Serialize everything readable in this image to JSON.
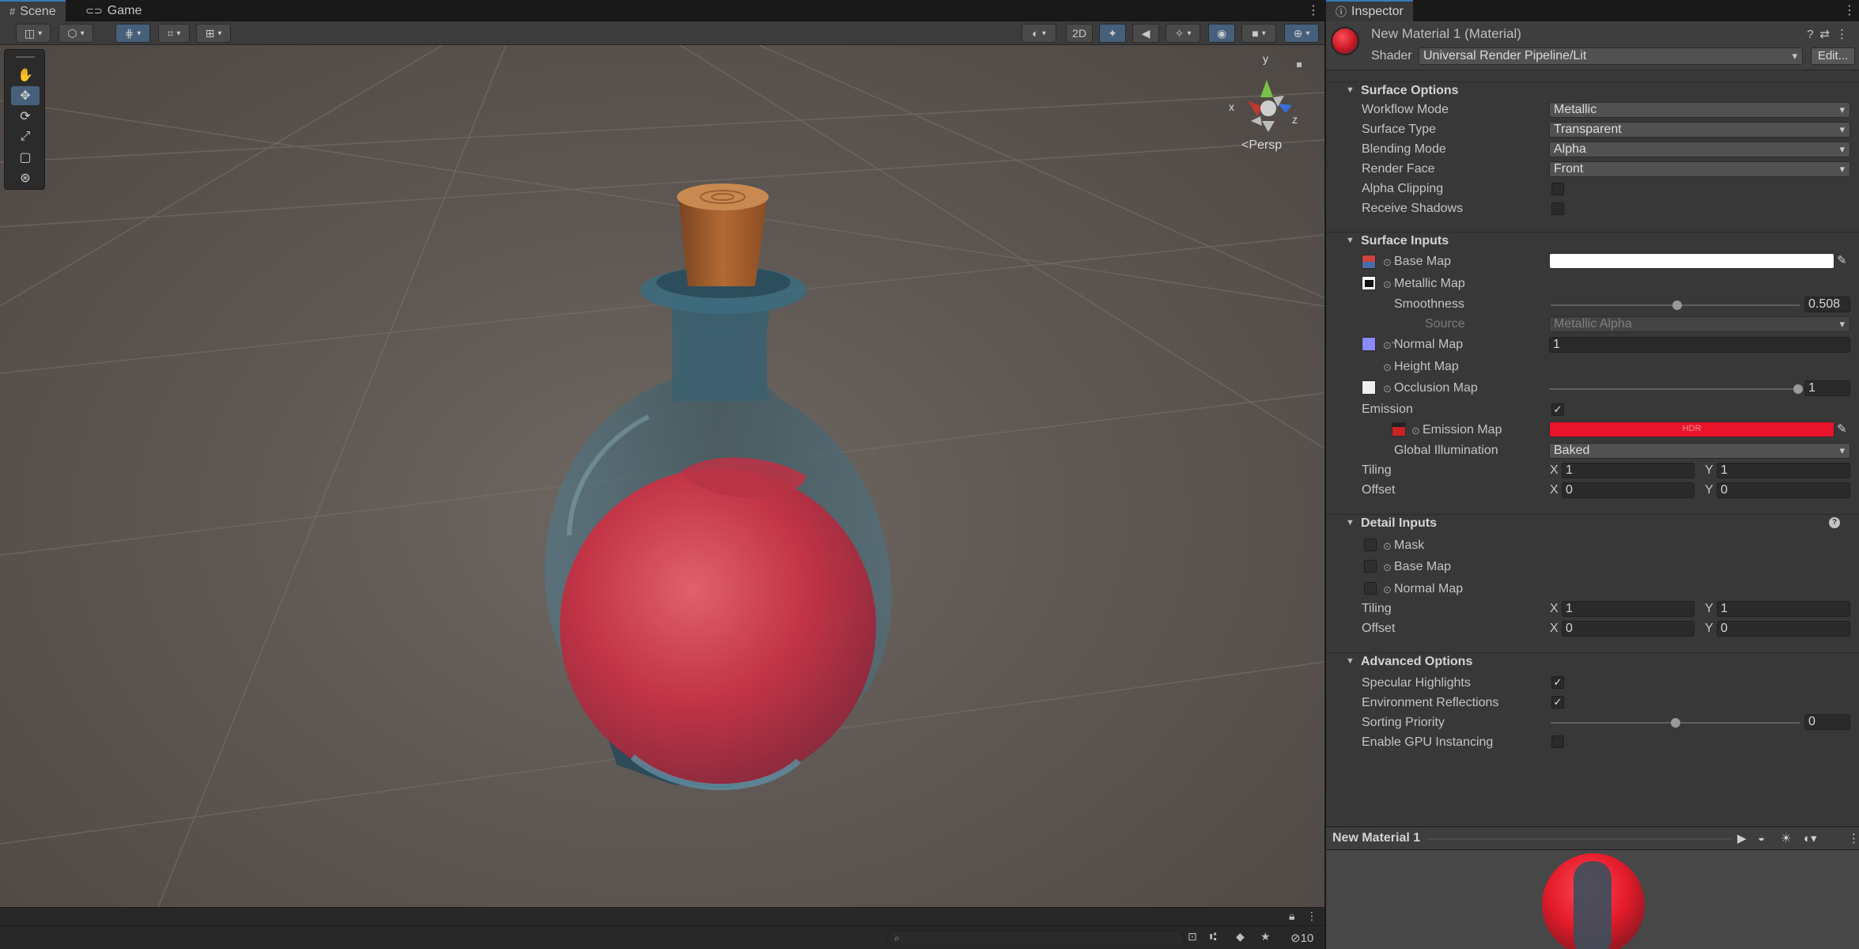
{
  "scene": {
    "tabs": [
      {
        "label": "Scene",
        "icon": "grid-icon",
        "active": true
      },
      {
        "label": "Game",
        "icon": "gamepad-icon",
        "active": false
      }
    ],
    "toolbar": {
      "mode_2d_label": "2D"
    },
    "gizmo": {
      "axis_y": "y",
      "axis_x": "x",
      "axis_z": "z",
      "projection": "Persp"
    },
    "statusbar": {
      "search_placeholder": "",
      "visible_count": "10"
    }
  },
  "inspector": {
    "tab_label": "Inspector",
    "material_title": "New Material 1 (Material)",
    "shader_label": "Shader",
    "shader_value": "Universal Render Pipeline/Lit",
    "edit_label": "Edit...",
    "surface_options": {
      "title": "Surface Options",
      "workflow_mode": {
        "label": "Workflow Mode",
        "value": "Metallic"
      },
      "surface_type": {
        "label": "Surface Type",
        "value": "Transparent"
      },
      "blending_mode": {
        "label": "Blending Mode",
        "value": "Alpha"
      },
      "render_face": {
        "label": "Render Face",
        "value": "Front"
      },
      "alpha_clipping": {
        "label": "Alpha Clipping",
        "checked": false
      },
      "receive_shadows": {
        "label": "Receive Shadows",
        "checked": false
      }
    },
    "surface_inputs": {
      "title": "Surface Inputs",
      "base_map": {
        "label": "Base Map",
        "color": "#ffffff"
      },
      "metallic_map": {
        "label": "Metallic Map"
      },
      "smoothness": {
        "label": "Smoothness",
        "value": "0.508",
        "fraction": 0.508
      },
      "source": {
        "label": "Source",
        "value": "Metallic Alpha"
      },
      "normal_map": {
        "label": "Normal Map",
        "value": "1"
      },
      "height_map": {
        "label": "Height Map"
      },
      "occlusion_map": {
        "label": "Occlusion Map",
        "value": "1",
        "fraction": 1.0
      },
      "emission": {
        "label": "Emission",
        "checked": true
      },
      "emission_map": {
        "label": "Emission Map",
        "color": "#e8142b",
        "hdr_label": "HDR"
      },
      "global_illumination": {
        "label": "Global Illumination",
        "value": "Baked"
      },
      "tiling": {
        "label": "Tiling",
        "x_label": "X",
        "x": "1",
        "y_label": "Y",
        "y": "1"
      },
      "offset": {
        "label": "Offset",
        "x_label": "X",
        "x": "0",
        "y_label": "Y",
        "y": "0"
      }
    },
    "detail_inputs": {
      "title": "Detail Inputs",
      "mask": {
        "label": "Mask"
      },
      "base_map": {
        "label": "Base Map"
      },
      "normal_map": {
        "label": "Normal Map"
      },
      "tiling": {
        "label": "Tiling",
        "x_label": "X",
        "x": "1",
        "y_label": "Y",
        "y": "1"
      },
      "offset": {
        "label": "Offset",
        "x_label": "X",
        "x": "0",
        "y_label": "Y",
        "y": "0"
      }
    },
    "advanced_options": {
      "title": "Advanced Options",
      "specular_highlights": {
        "label": "Specular Highlights",
        "checked": true
      },
      "environment_reflections": {
        "label": "Environment Reflections",
        "checked": true
      },
      "sorting_priority": {
        "label": "Sorting Priority",
        "value": "0",
        "fraction": 0.5
      },
      "gpu_instancing": {
        "label": "Enable GPU Instancing",
        "checked": false
      }
    },
    "preview": {
      "title": "New Material 1"
    }
  },
  "colors": {
    "accent": "#3a79bb",
    "potion_liquid": "#c8354a",
    "glass": "#3e6577",
    "cork": "#b46a2e"
  }
}
